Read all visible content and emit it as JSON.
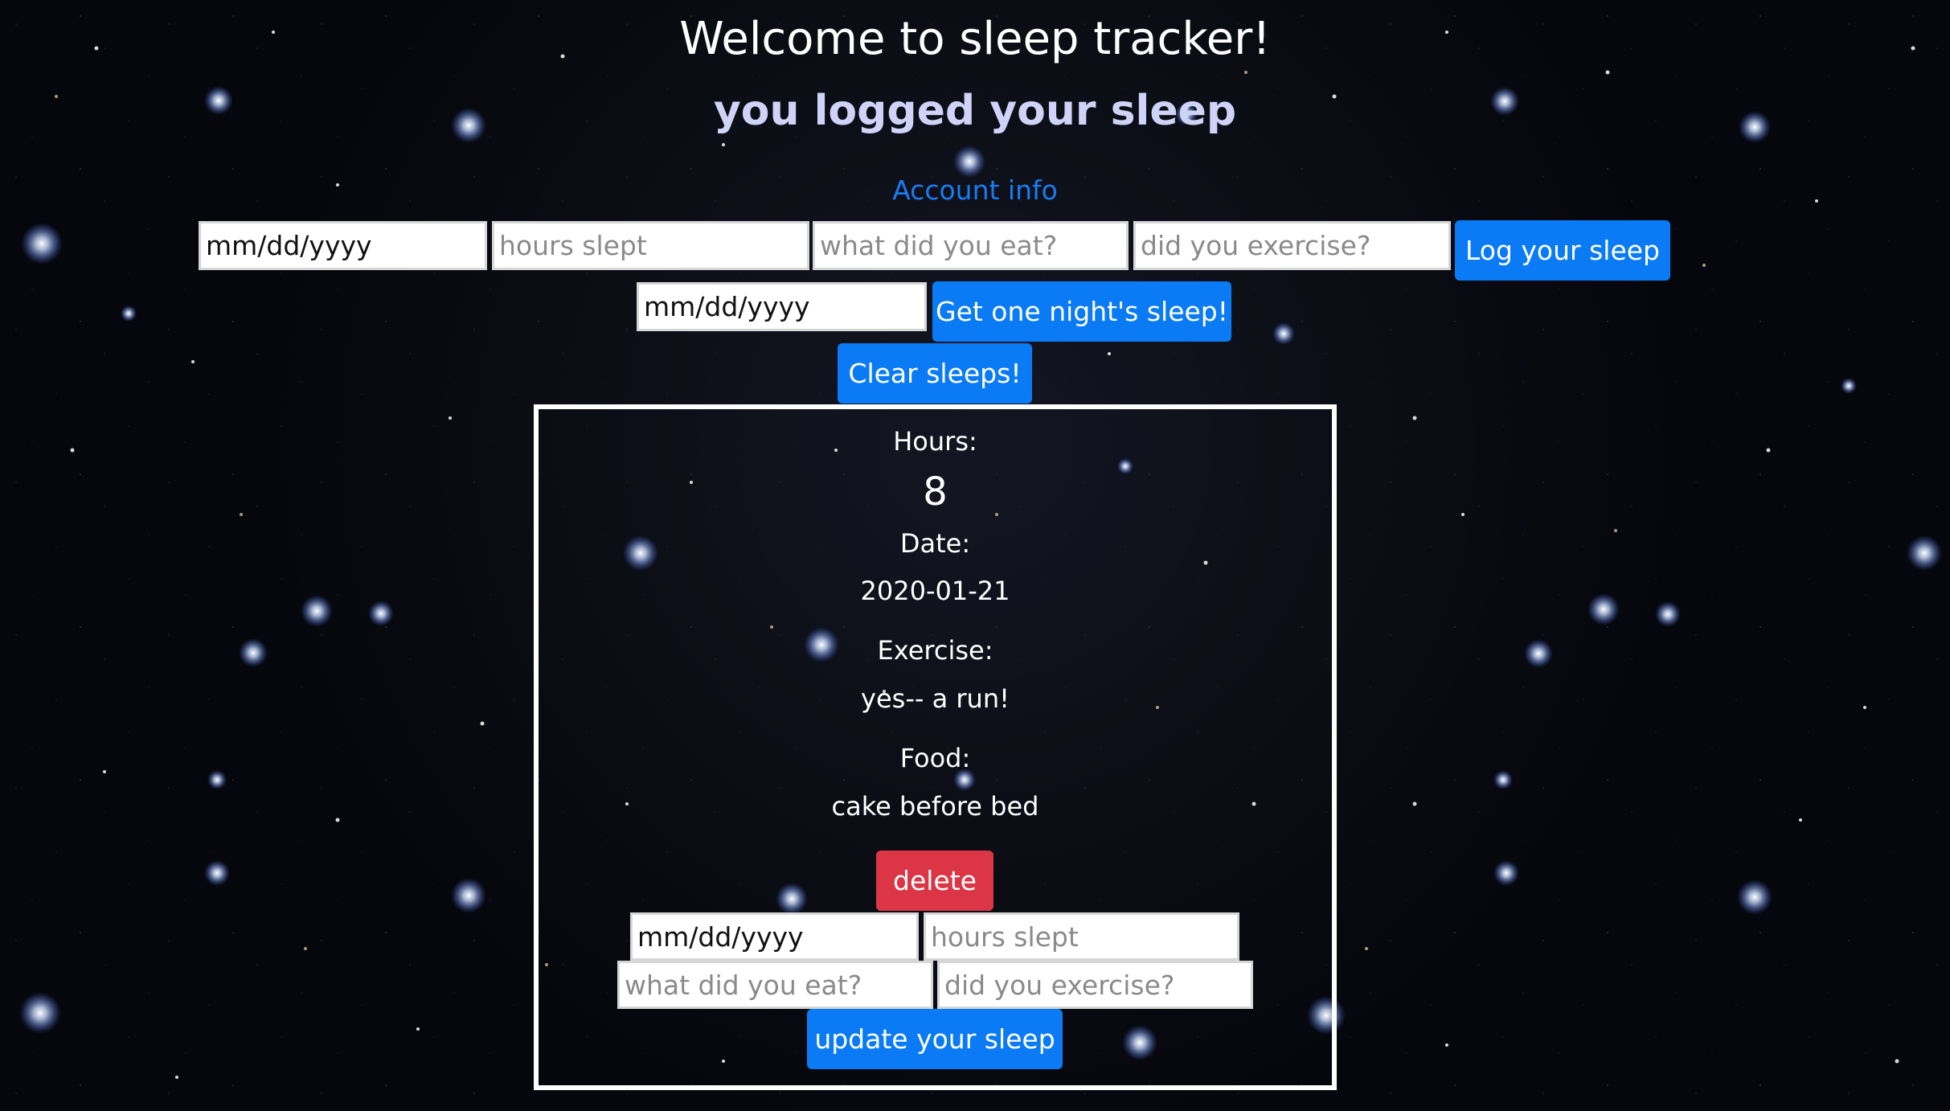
{
  "header": {
    "title": "Welcome to sleep tracker!",
    "subtitle": "you logged your sleep",
    "account_link": "Account info"
  },
  "log_form": {
    "date_placeholder": "mm/dd/yyyy",
    "hours_placeholder": "hours slept",
    "food_placeholder": "what did you eat?",
    "exercise_placeholder": "did you exercise?",
    "submit_label": "Log your sleep"
  },
  "get_form": {
    "date_placeholder": "mm/dd/yyyy",
    "submit_label": "Get one night's sleep!"
  },
  "clear_label": "Clear sleeps!",
  "sleep_entry": {
    "hours_label": "Hours:",
    "hours_value": "8",
    "date_label": "Date:",
    "date_value": "2020-01-21",
    "exercise_label": "Exercise:",
    "exercise_value": "yes-- a run!",
    "food_label": "Food:",
    "food_value": "cake before bed",
    "delete_label": "delete",
    "update_form": {
      "date_placeholder": "mm/dd/yyyy",
      "hours_placeholder": "hours slept",
      "food_placeholder": "what did you eat?",
      "exercise_placeholder": "did you exercise?",
      "submit_label": "update your sleep"
    }
  },
  "colors": {
    "primary_button": "#0a7bf5",
    "danger_button": "#dc3545",
    "link": "#1a7cf2",
    "subtitle": "#cfd3f7",
    "background": "#06070c"
  }
}
